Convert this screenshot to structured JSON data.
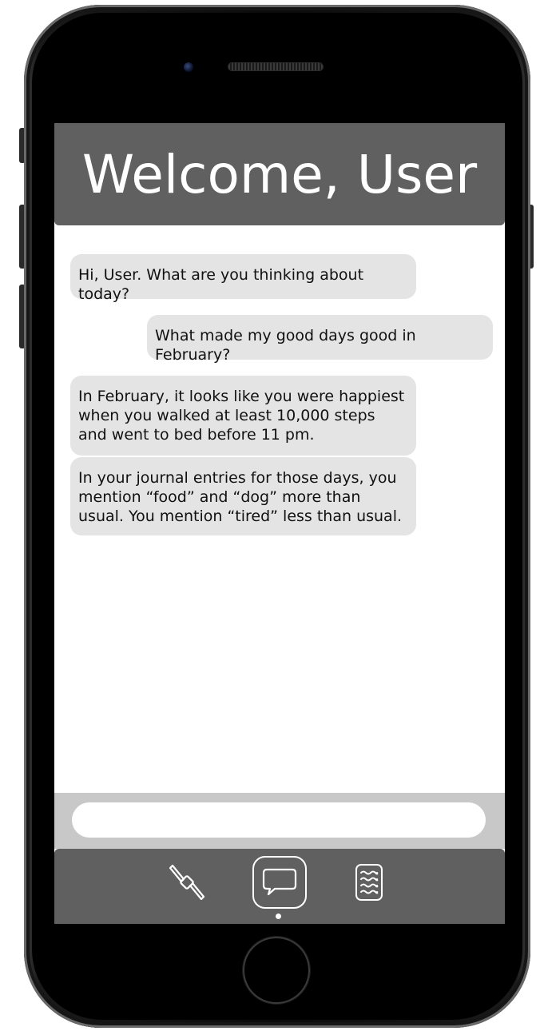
{
  "header": {
    "title": "Welcome, User"
  },
  "chat": {
    "messages": [
      {
        "sender": "assistant",
        "text": "Hi, User. What are you thinking about today?"
      },
      {
        "sender": "user",
        "text": "What made my good days good in February?"
      },
      {
        "sender": "assistant",
        "text": "In February, it looks like you were happiest when you walked at least 10,000 steps and went to bed before 11 pm."
      },
      {
        "sender": "assistant",
        "text": "In your journal entries for those days, you mention “food” and “dog” more than usual. You mention “tired” less than usual."
      }
    ]
  },
  "composer": {
    "value": "",
    "placeholder": ""
  },
  "tab_bar": {
    "tabs": [
      {
        "icon": "fitness-tracker-icon",
        "active": false
      },
      {
        "icon": "chat-bubble-icon",
        "active": true
      },
      {
        "icon": "journal-icon",
        "active": false
      }
    ]
  },
  "colors": {
    "header_bg": "#606060",
    "bubble_bg": "#e4e4e4",
    "input_bar_bg": "#c8c8c8",
    "tab_bar_bg": "#606060"
  }
}
